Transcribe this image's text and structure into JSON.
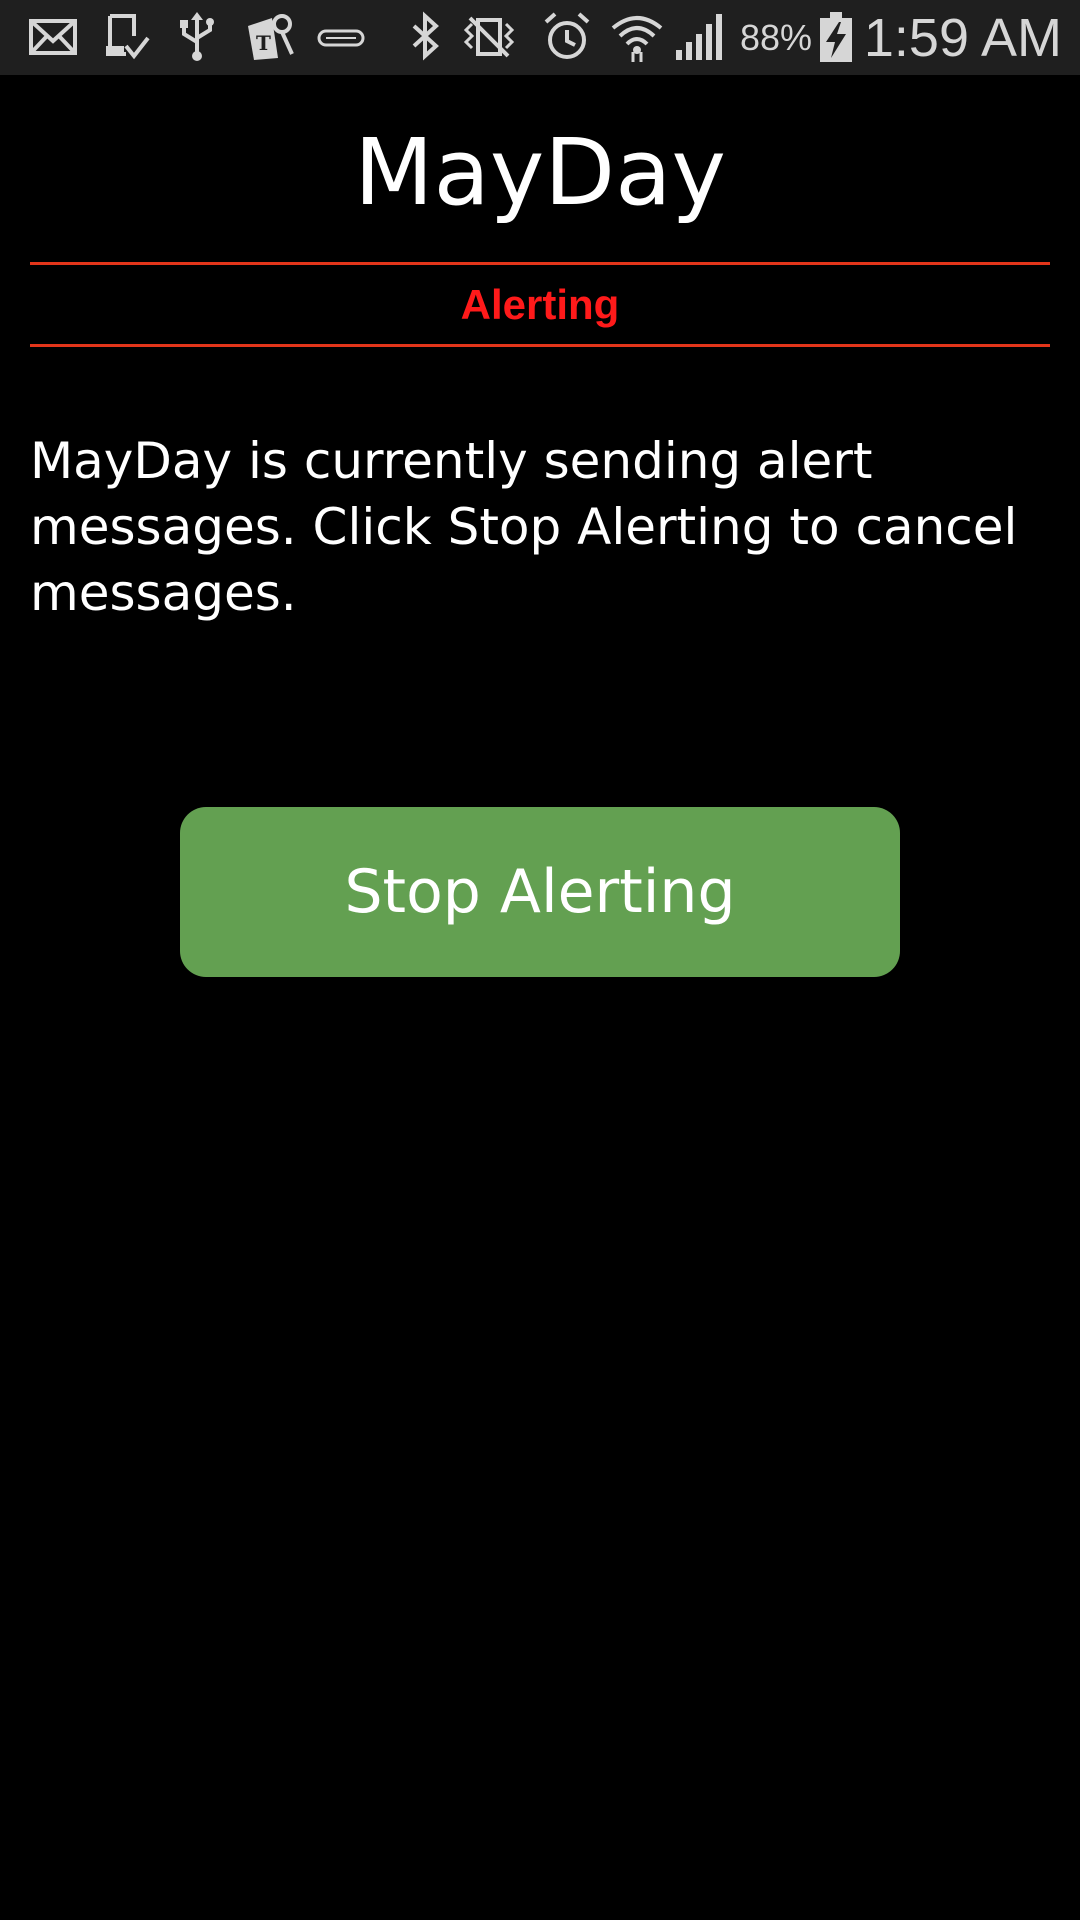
{
  "status_bar": {
    "icons": [
      "email-icon",
      "download-complete-icon",
      "usb-icon",
      "t-mobile-icon",
      "cast-icon",
      "bluetooth-icon",
      "vibrate-mute-icon",
      "alarm-icon",
      "wifi-icon",
      "signal-icon",
      "battery-charging-icon"
    ],
    "battery_percent": "88%",
    "time": "1:59 AM"
  },
  "app": {
    "title": "MayDay",
    "status": "Alerting",
    "message": "MayDay is currently sending alert messages. Click Stop Alerting to cancel messages.",
    "stop_button_label": "Stop Alerting"
  },
  "colors": {
    "background": "#000000",
    "status_bar_bg": "#1f1f1f",
    "divider": "#e2351a",
    "status_text": "#ff1a1a",
    "button_bg": "#63a051",
    "text": "#ffffff"
  }
}
